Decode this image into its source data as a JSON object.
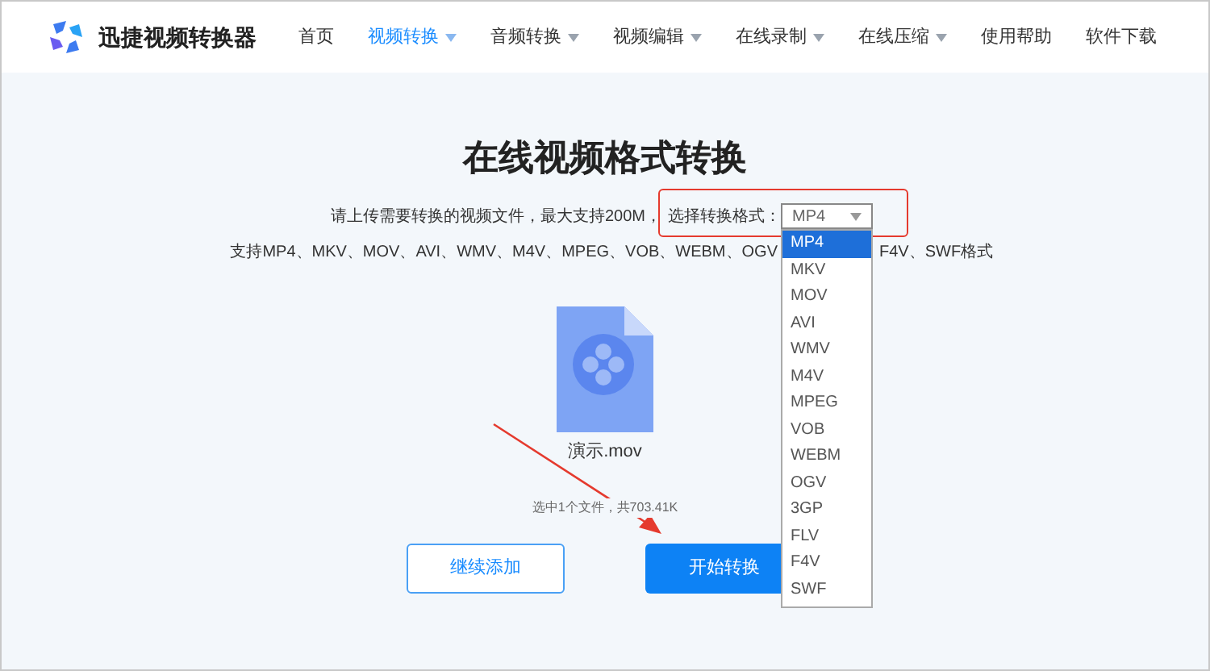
{
  "brand": {
    "name": "迅捷视频转换器"
  },
  "nav": [
    {
      "label": "首页",
      "selected": false,
      "has_menu": false
    },
    {
      "label": "视频转换",
      "selected": true,
      "has_menu": true
    },
    {
      "label": "音频转换",
      "selected": false,
      "has_menu": true
    },
    {
      "label": "视频编辑",
      "selected": false,
      "has_menu": true
    },
    {
      "label": "在线录制",
      "selected": false,
      "has_menu": true
    },
    {
      "label": "在线压缩",
      "selected": false,
      "has_menu": true
    },
    {
      "label": "使用帮助",
      "selected": false,
      "has_menu": false
    },
    {
      "label": "软件下载",
      "selected": false,
      "has_menu": false
    }
  ],
  "title": "在线视频格式转换",
  "upload_hint": "请上传需要转换的视频文件，最大支持200M，",
  "format_label": "选择转换格式：",
  "format_select": {
    "value": "MP4",
    "expanded": true
  },
  "format_options": [
    {
      "label": "MP4",
      "selected": true
    },
    {
      "label": "MKV",
      "selected": false
    },
    {
      "label": "MOV",
      "selected": false
    },
    {
      "label": "AVI",
      "selected": false
    },
    {
      "label": "WMV",
      "selected": false
    },
    {
      "label": "M4V",
      "selected": false
    },
    {
      "label": "MPEG",
      "selected": false
    },
    {
      "label": "VOB",
      "selected": false
    },
    {
      "label": "WEBM",
      "selected": false
    },
    {
      "label": "OGV",
      "selected": false
    },
    {
      "label": "3GP",
      "selected": false
    },
    {
      "label": "FLV",
      "selected": false
    },
    {
      "label": "F4V",
      "selected": false
    },
    {
      "label": "SWF",
      "selected": false
    }
  ],
  "supported_formats": {
    "before": "支持MP4、MKV、MOV、AVI、WMV、M4V、MPEG、VOB、WEBM、OGV",
    "after": "F4V、SWF格式"
  },
  "file": {
    "name": "演示.mov"
  },
  "summary": "选中1个文件，共703.41K",
  "buttons": [
    {
      "label": "继续添加",
      "kind": "secondary"
    },
    {
      "label": "开始转换",
      "kind": "primary"
    }
  ]
}
